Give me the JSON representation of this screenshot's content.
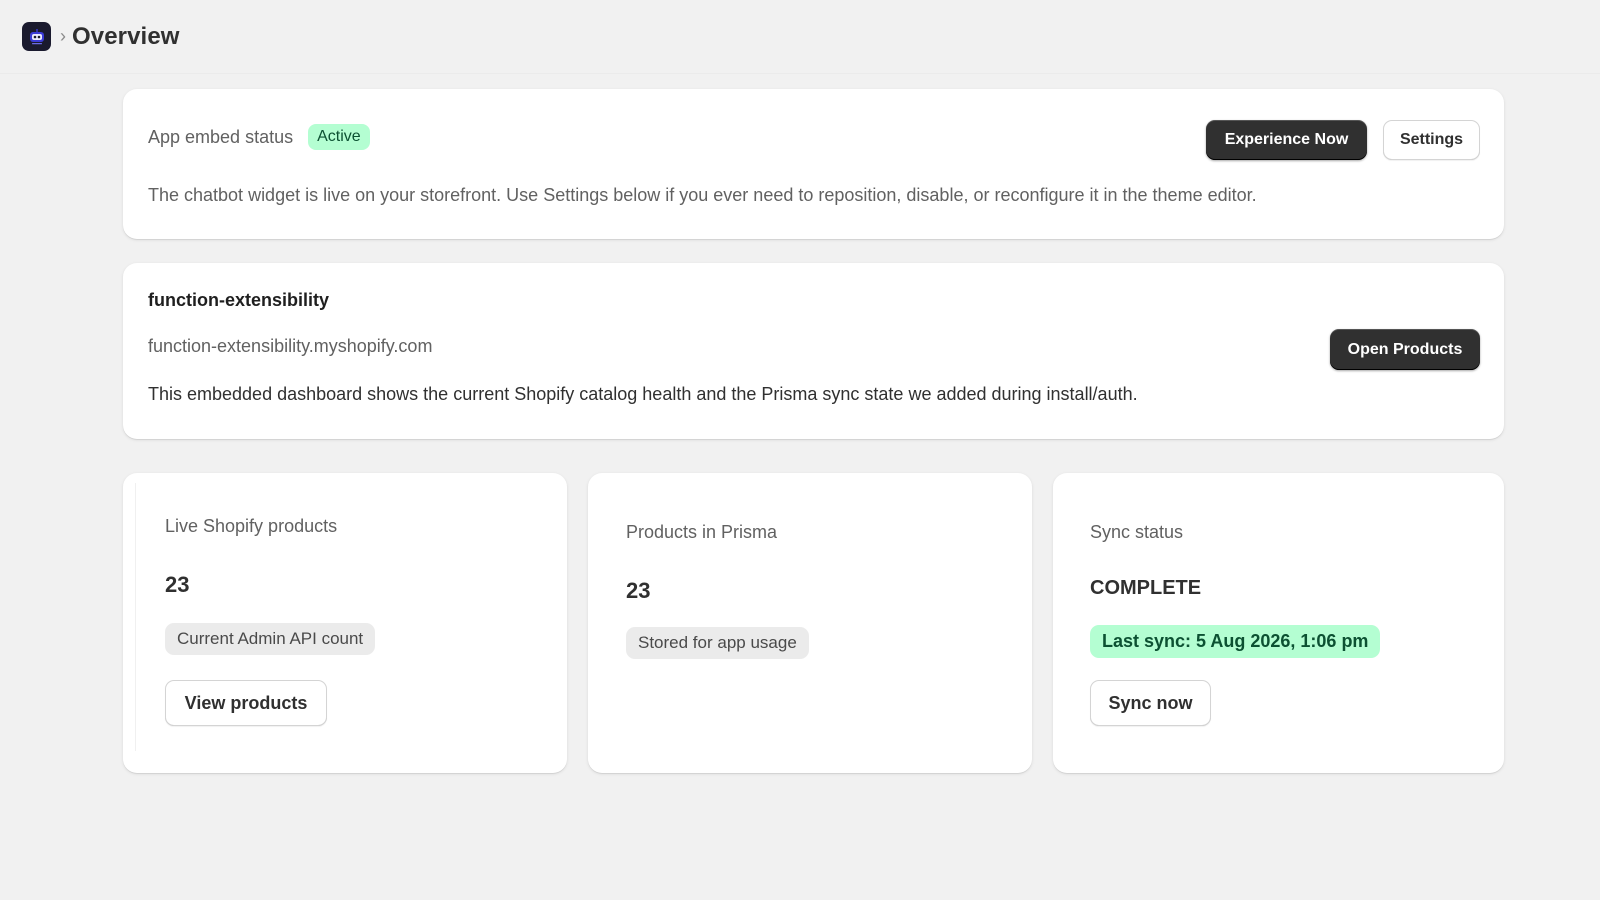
{
  "header": {
    "breadcrumb_separator": "›",
    "title": "Overview"
  },
  "embed": {
    "label": "App embed status",
    "status_badge": "Active",
    "primary_button": "Experience Now",
    "secondary_button": "Settings",
    "description": "The chatbot widget is live on your storefront. Use Settings below if you ever need to reposition, disable, or reconfigure it in the theme editor."
  },
  "store": {
    "name": "function-extensibility",
    "domain": "function-extensibility.myshopify.com",
    "description": "This embedded dashboard shows the current Shopify catalog health and the Prisma sync state we added during install/auth.",
    "button": "Open Products"
  },
  "stats": {
    "live": {
      "label": "Live Shopify products",
      "value": "23",
      "note": "Current Admin API count",
      "button": "View products"
    },
    "prisma": {
      "label": "Products in Prisma",
      "value": "23",
      "note": "Stored for app usage"
    },
    "sync": {
      "label": "Sync status",
      "value": "COMPLETE",
      "note": "Last sync: 5 Aug 2026, 1:06 pm",
      "button": "Sync now"
    }
  },
  "colors": {
    "page_bg": "#f1f1f1",
    "card_bg": "#ffffff",
    "dark_button": "#303030",
    "success_bg": "#b4fed2",
    "success_text": "#0c5132"
  },
  "icons": {
    "app_logo": "robot-app-icon"
  }
}
